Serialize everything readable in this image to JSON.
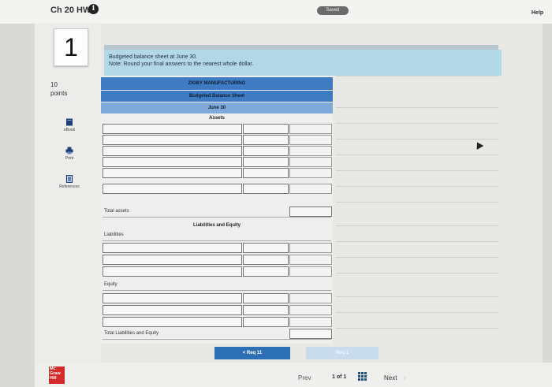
{
  "header": {
    "title": "Ch 20 HW",
    "saved_label": "Saved",
    "help_label": "Help"
  },
  "question": {
    "number": "1",
    "points_value": "10",
    "points_label": "points"
  },
  "sidebar": {
    "tools": [
      {
        "label": "eBook",
        "icon": "book-icon"
      },
      {
        "label": "Print",
        "icon": "print-icon"
      },
      {
        "label": "References",
        "icon": "references-icon"
      }
    ]
  },
  "instructions": {
    "line1": "Budgeted balance sheet at June 30.",
    "line2": "Note: Round your final answers to the nearest whole dollar."
  },
  "statement": {
    "company": "ZIGBY MANUFACTURING",
    "title": "Budgeted Balance Sheet",
    "date": "June 30",
    "assets_heading": "Assets",
    "total_assets": "Total assets",
    "liab_equity_heading": "Liabilities and Equity",
    "liabilities_label": "Liabilities",
    "equity_label": "Equity",
    "total_liab_equity": "Total Liabilities and Equity"
  },
  "navigation": {
    "req_button": "< Req 11",
    "next_req_button": "Req 1",
    "prev": "Prev",
    "page_current": "1",
    "page_of": "of",
    "page_total": "1",
    "next": "Next"
  },
  "logo": {
    "line1": "Mc",
    "line2": "Graw",
    "line3": "Hill"
  },
  "colors": {
    "blue_band": "#3f7bc3",
    "header_box": "#b2d7e6",
    "req_button": "#2d6fb5",
    "logo": "#d42a2a"
  }
}
